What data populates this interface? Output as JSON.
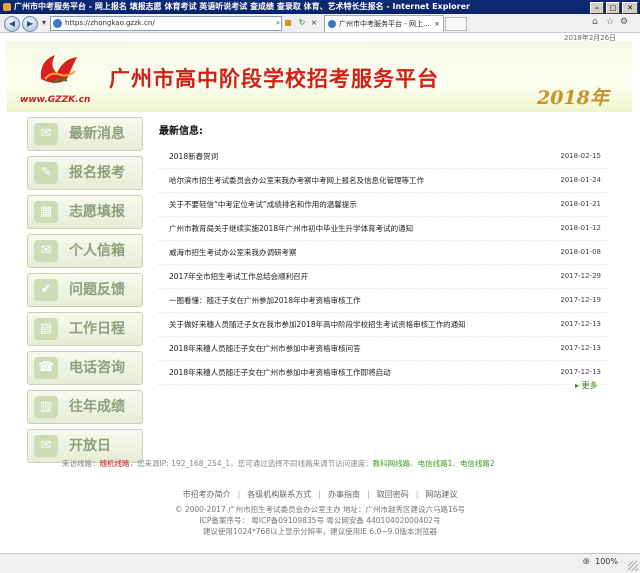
{
  "window": {
    "title": "广州市中考服务平台 - 网上报名 填报志愿 体育考试 英语听说考试 查成绩 查录取 体育、艺术特长生报名 - Internet Explorer",
    "min_label": "–",
    "max_label": "□",
    "close_label": "✕"
  },
  "toolbar": {
    "back_glyph": "◀",
    "forward_glyph": "▶",
    "url": "https://zhongkao.gzzk.cn/",
    "search_glyph": "⌕",
    "dropdown_glyph": "▾",
    "tab_label": "广州市中考服务平台 - 网上...",
    "tab_close": "×",
    "home_glyph": "⌂",
    "fav_glyph": "☆",
    "settings_glyph": "⚙"
  },
  "date_text": "2018年2月26日",
  "banner": {
    "site_logo_text": "www.GZZK.cn",
    "title": "广州市高中阶段学校招考服务平台",
    "year": "2018年"
  },
  "sidebar": {
    "items": [
      {
        "label": "最新消息",
        "icon": "news-icon",
        "glyph": "✉"
      },
      {
        "label": "报名报考",
        "icon": "register-icon",
        "glyph": "✎"
      },
      {
        "label": "志愿填报",
        "icon": "wish-icon",
        "glyph": "▦"
      },
      {
        "label": "个人信箱",
        "icon": "mailbox-icon",
        "glyph": "✉"
      },
      {
        "label": "问题反馈",
        "icon": "feedback-icon",
        "glyph": "✔"
      },
      {
        "label": "工作日程",
        "icon": "calendar-icon",
        "glyph": "▤"
      },
      {
        "label": "电话咨询",
        "icon": "phone-icon",
        "glyph": "☎"
      },
      {
        "label": "往年成绩",
        "icon": "scores-icon",
        "glyph": "▥"
      },
      {
        "label": "开放日",
        "icon": "openday-icon",
        "glyph": "✉"
      }
    ]
  },
  "news": {
    "heading": "最新信息:",
    "items": [
      {
        "title": "2018新春贺词",
        "date": "2018-02-15"
      },
      {
        "title": "哈尔滨市招生考试委员会办公室来我办考察中考网上报名及信息化管理等工作",
        "date": "2018-01-24"
      },
      {
        "title": "关于不要轻信“中考定位考试”成绩排名和作用的温馨提示",
        "date": "2018-01-21"
      },
      {
        "title": "广州市教育局关于继续实施2018年广州市初中毕业生升学体育考试的通知",
        "date": "2018-01-12"
      },
      {
        "title": "威海市招生考试办公室来我办调研考察",
        "date": "2018-01-08"
      },
      {
        "title": "2017年全市招生考试工作总结会顺利召开",
        "date": "2017-12-29"
      },
      {
        "title": "一图看懂：随迁子女在广州参加2018年中考资格审核工作",
        "date": "2017-12-19"
      },
      {
        "title": "关于做好来穗人员随迁子女在我市参加2018年高中阶段学校招生考试资格审核工作的通知",
        "date": "2017-12-13"
      },
      {
        "title": "2018年来穗人员随迁子女在广州市参加中考资格审核问答",
        "date": "2017-12-13"
      },
      {
        "title": "2018年来穗人员随迁子女在广州市参加中考资格审核工作即将启动",
        "date": "2017-12-13"
      }
    ],
    "more": "更多",
    "more_glyph": "▸"
  },
  "line_info": {
    "prefix": "来访线路：",
    "current": "随机线路",
    "middle": "，您来源IP: 192_168_254_1，您可通过选择不同线路来调节访问速度：",
    "links": [
      "教科网线路",
      "电信线路1",
      "电信线路2"
    ]
  },
  "footer_nav": [
    "市招考办简介",
    "各级机构联系方式",
    "办事指南",
    "取回密码",
    "网站建议"
  ],
  "footer_nav_sep": "|",
  "footer_lines": [
    "© 2000-2017 广州市招生考试委员会办公室主办 地址：广州市越秀区建设六马路16号",
    "ICP备案序号： 粤ICP备09109835号 粤公网安备 44010402000402号",
    "建议使用1024*768以上显示分辨率，建议使用IE 6.0~9.0版本浏览器"
  ],
  "statusbar": {
    "zoom": "100%",
    "zoom_glyph": "⊕"
  },
  "colors": {
    "accent_red": "#d31f16",
    "year_gold": "#c9922a",
    "link_green": "#3ba01a",
    "sidebar_text": "#8f9f7a"
  }
}
